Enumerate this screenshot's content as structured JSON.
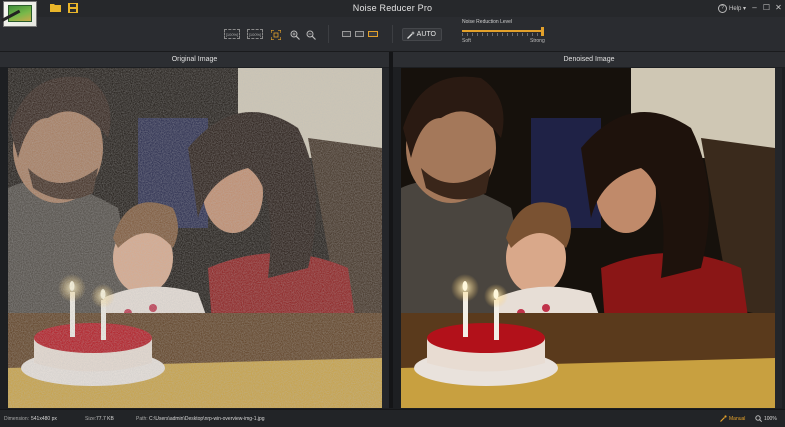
{
  "app": {
    "title": "Noise Reducer Pro",
    "help_label": "Help",
    "help_chevron": "▾"
  },
  "window_controls": {
    "minimize": "–",
    "maximize": "☐",
    "close": "✕"
  },
  "toolbar": {
    "zoom_fit_label": "[100%]",
    "zoom_100_label": "[100%]",
    "auto_label": "AUTO",
    "noise_reduction_label": "Noise Reduction Level",
    "slider_min_label": "Soft",
    "slider_max_label": "Strong",
    "slider_value": 1.0
  },
  "panels": {
    "left_title": "Original Image",
    "right_title": "Denoised Image"
  },
  "statusbar": {
    "dimension_label": "Dimension:",
    "dimension_value": "541x480 px",
    "size_label": "Size:",
    "size_value": "77.7 KB",
    "path_label": "Path:",
    "path_value": "C:\\Users\\admin\\Desktop\\nrp-win-overview-img-1.jpg",
    "mode_label": "Manual",
    "zoom_value": "100%"
  },
  "colors": {
    "accent": "#e3a12b",
    "background": "#1d1f22",
    "toolbar": "#2a2c30"
  }
}
